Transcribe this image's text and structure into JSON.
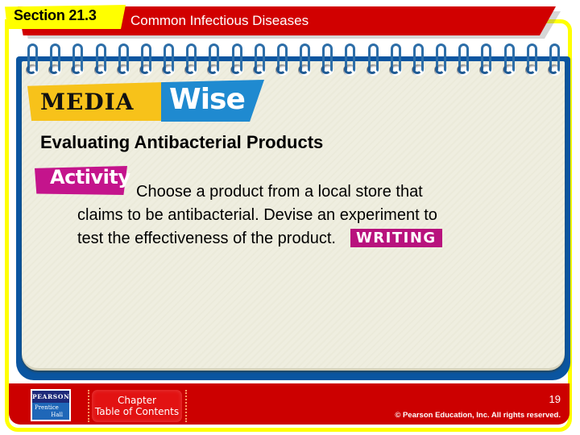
{
  "header": {
    "section_label": "Section 21.3",
    "chapter_title": "Common Infectious Diseases"
  },
  "notebook": {
    "spiral_ring_count": 24
  },
  "banner": {
    "media": "MEDIA",
    "wise": "Wise"
  },
  "content": {
    "title": "Evaluating Antibacterial Products",
    "activity_label": "Activity",
    "lines": [
      "Choose a product from a local store that",
      "claims to be antibacterial. Devise an experiment to",
      "test the effectiveness of the product."
    ],
    "writing_label": "WRITING"
  },
  "footer": {
    "logo": {
      "top": "PEARSON",
      "bottom_line1": "Prentice",
      "bottom_line2": "Hall"
    },
    "toc_button": {
      "line1": "Chapter",
      "line2": "Table of Contents"
    },
    "page_number": "19",
    "copyright": "© Pearson Education, Inc. All rights reserved."
  },
  "colors": {
    "header_red": "#d10000",
    "frame_yellow": "#ffff00",
    "notebook_blue": "#0a55a0",
    "media_yellow": "#f7c21a",
    "wise_blue": "#1f8ad0",
    "activity_magenta": "#c4148c",
    "footer_red": "#cc0000"
  }
}
